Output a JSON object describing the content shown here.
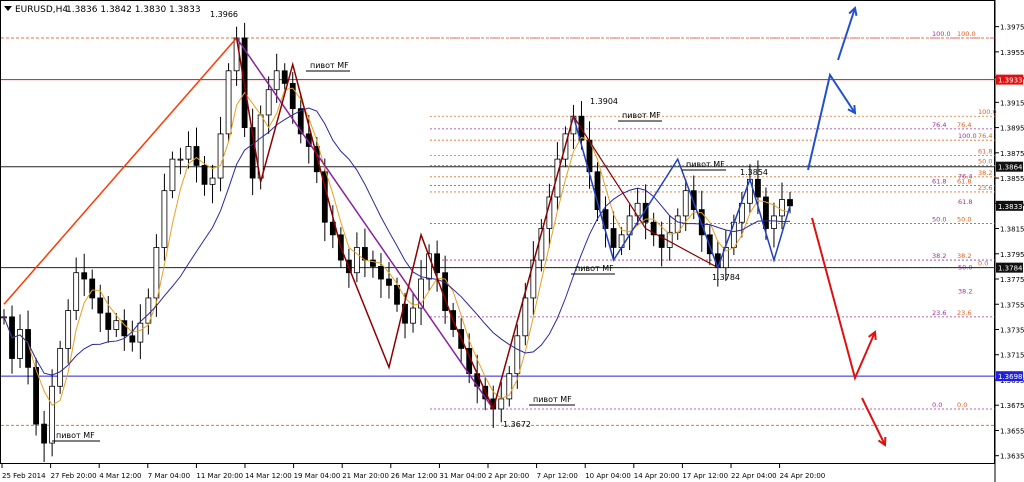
{
  "header": {
    "icon": "triangle-down-icon",
    "symbol": "EURUSD,H4",
    "ohlc": "1.3836 1.3842 1.3830 1.3833"
  },
  "chart_data": {
    "type": "candlestick",
    "symbol": "EURUSD",
    "timeframe": "H4",
    "ylim": [
      1.363,
      1.3985
    ],
    "y_ticks": [
      "1.3975",
      "1.3955",
      "1.3935",
      "1.3915",
      "1.3895",
      "1.3875",
      "1.3855",
      "1.3835",
      "1.3815",
      "1.3795",
      "1.3775",
      "1.3755",
      "1.3735",
      "1.3715",
      "1.3695",
      "1.3675",
      "1.3655",
      "1.3635"
    ],
    "x_ticks": [
      "25 Feb 2014",
      "27 Feb 20:00",
      "4 Mar 12:00",
      "7 Mar 04:00",
      "11 Mar 20:00",
      "14 Mar 12:00",
      "19 Mar 04:00",
      "21 Mar 20:00",
      "26 Mar 12:00",
      "31 Mar 04:00",
      "2 Apr 20:00",
      "7 Apr 12:00",
      "10 Apr 04:00",
      "14 Apr 20:00",
      "17 Apr 12:00",
      "22 Apr 04:00",
      "24 Apr 20:00"
    ],
    "price_tags": [
      {
        "value": "1.3933",
        "color": "#e01010"
      },
      {
        "value": "1.3864",
        "color": "#111111"
      },
      {
        "value": "1.3833",
        "color": "#111111"
      },
      {
        "value": "1.3784",
        "color": "#111111"
      },
      {
        "value": "1.3698",
        "color": "#2020e0"
      }
    ],
    "horizontal_lines": [
      {
        "price": 1.3933,
        "color": "#e01010",
        "style": "solid"
      },
      {
        "price": 1.3864,
        "color": "#222222",
        "style": "solid"
      },
      {
        "price": 1.3784,
        "color": "#222222",
        "style": "solid"
      },
      {
        "price": 1.3698,
        "color": "#2020e0",
        "style": "solid"
      },
      {
        "price": 1.3966,
        "color": "#f07030",
        "style": "dashed"
      },
      {
        "price": 1.3659,
        "color": "#f07030",
        "style": "dashed"
      }
    ],
    "price_labels": [
      "1.3966",
      "1.3904",
      "1.3854",
      "1.3784",
      "1.3672"
    ],
    "pivot_label": "пивот MF",
    "fib_labels_purple": [
      "100.0",
      "76.4",
      "61.8",
      "50.0",
      "38.2",
      "23.6",
      "0.0"
    ],
    "fib_labels_orange": [
      "100.0",
      "76.4",
      "61.8",
      "50.0",
      "38.2",
      "23.6",
      "0.0"
    ],
    "fib_labels_orange_extra": [
      "100.0",
      "76.4",
      "61.8",
      "50.0",
      "38.2",
      "23.6",
      "0.0"
    ],
    "fib_labels_extra": [
      "100.0",
      "76.4",
      "61.8",
      "50.0",
      "38.2"
    ],
    "fib_levels_a": [
      1.3966,
      1.3894,
      1.3849,
      1.3819,
      1.379,
      1.3745,
      1.3672
    ],
    "fib_levels_b": [
      1.3904,
      1.3885,
      1.3873,
      1.3865,
      1.3856,
      1.3844,
      1.3784
    ],
    "closes": [
      1.3745,
      1.3712,
      1.3735,
      1.3705,
      1.366,
      1.3645,
      1.369,
      1.372,
      1.375,
      1.378,
      1.3775,
      1.376,
      1.3748,
      1.3735,
      1.3742,
      1.373,
      1.3725,
      1.374,
      1.376,
      1.38,
      1.3845,
      1.387,
      1.387,
      1.388,
      1.3865,
      1.385,
      1.3855,
      1.389,
      1.394,
      1.3966,
      1.3895,
      1.3855,
      1.3905,
      1.3925,
      1.394,
      1.393,
      1.391,
      1.389,
      1.388,
      1.386,
      1.382,
      1.381,
      1.379,
      1.378,
      1.38,
      1.379,
      1.3785,
      1.3775,
      1.377,
      1.3755,
      1.374,
      1.3752,
      1.3775,
      1.3795,
      1.378,
      1.375,
      1.3735,
      1.372,
      1.37,
      1.369,
      1.368,
      1.3672,
      1.368,
      1.37,
      1.373,
      1.376,
      1.379,
      1.3815,
      1.384,
      1.387,
      1.389,
      1.3904,
      1.3885,
      1.386,
      1.383,
      1.3815,
      1.38,
      1.381,
      1.3825,
      1.3835,
      1.382,
      1.381,
      1.38,
      1.3812,
      1.3825,
      1.3845,
      1.383,
      1.381,
      1.3795,
      1.3784,
      1.38,
      1.382,
      1.3835,
      1.3854,
      1.384,
      1.3815,
      1.3825,
      1.3838,
      1.3833
    ]
  }
}
